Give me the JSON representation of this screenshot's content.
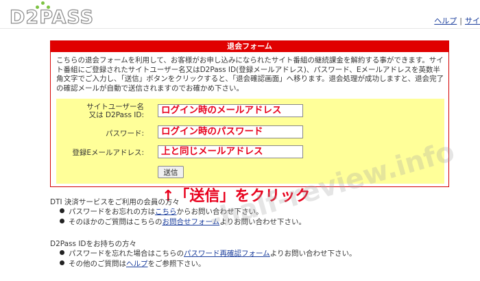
{
  "header": {
    "logo_text": "D2PASS",
    "nav": [
      {
        "label": "ヘルプ"
      },
      {
        "label": "サイ"
      }
    ],
    "separator": "|"
  },
  "panel": {
    "title": "退会フォーム",
    "intro": "こちらの退会フォームを利用して、お客様がお申し込みになられたサイト番組の継続課金を解約する事ができます。サイト番組にご登録されたサイトユーザー名又はD2Pass ID(登録メールアドレス)、パスワード、Eメールアドレスを英数半角文字でご入力し、「送信」ボタンをクリックすると、「退会確認画面」へ移ります。退会処理が成功しますと、退会完了の確認メールが自動で送信されますのでお確かめ下さい。",
    "fields": {
      "username": {
        "label_line1": "サイトユーザー名",
        "label_line2": "又は D2Pass ID:",
        "value": "ログイン時のメールアドレス"
      },
      "password": {
        "label": "パスワード:",
        "value": "ログイン時のパスワード"
      },
      "email": {
        "label": "登録Eメールアドレス:",
        "value": "上と同じメールアドレス"
      }
    },
    "submit_label": "送信"
  },
  "annotation": "↑「送信」をクリック",
  "dti": {
    "title": "DTI 決済サービスをご利用の会員の方々",
    "items": [
      {
        "pre": "パスワードをお忘れの方は",
        "link": "こちら",
        "post": "からお問い合わせ下さい。"
      },
      {
        "pre": "そのほかのご質問はこちらの",
        "link": "お問合せフォーム",
        "post": "よりお問い合わせ下さい。"
      }
    ]
  },
  "d2pass": {
    "title": "D2Pass IDをお持ちの方々",
    "items": [
      {
        "pre": "パスワードを忘れた場合はこちらの",
        "link": "パスワード再確認フォーム",
        "post": "よりお問い合わせ下さい。"
      },
      {
        "pre": "その他のご質問は",
        "link": "ヘルプ",
        "post": "をご参照下さい。"
      }
    ]
  },
  "watermark": "-half-review.info",
  "colors": {
    "panel_red": "#e00000",
    "form_yellow": "#ffff99",
    "annotation_red": "#e8001c",
    "link_blue": "#1a3d9c"
  }
}
